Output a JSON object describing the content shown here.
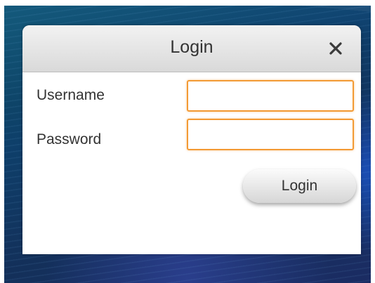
{
  "dialog": {
    "title": "Login",
    "close_icon": "close-icon",
    "username_label": "Username",
    "username_value": "",
    "password_label": "Password",
    "password_value": "",
    "login_button_label": "Login"
  },
  "colors": {
    "input_border": "#f39a34",
    "titlebar_top": "#f2f2f2",
    "titlebar_bottom": "#d9d9d9",
    "text": "#333333"
  }
}
